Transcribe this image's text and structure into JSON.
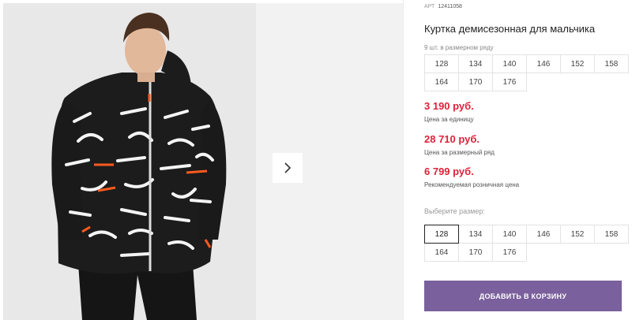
{
  "gallery": {
    "photo_alt": "boy-in-printed-jacket",
    "next_icon": "chevron-right-icon"
  },
  "product": {
    "sku_label": "АРТ",
    "sku_code": "12411058",
    "title": "Куртка демисезонная для мальчика",
    "row_note": "9 шт. в размерном ряду",
    "row_sizes": [
      "128",
      "134",
      "140",
      "146",
      "152",
      "158",
      "164",
      "170",
      "176"
    ]
  },
  "prices": {
    "unit": {
      "value": "3 190 руб.",
      "label": "Цена за единицу"
    },
    "row": {
      "value": "28 710 руб.",
      "label": "Цена за размерный ряд"
    },
    "retail": {
      "value": "6 799 руб.",
      "label": "Рекомендуемая розничная цена"
    }
  },
  "size_picker": {
    "label": "Выберите размер:",
    "sizes": [
      "128",
      "134",
      "140",
      "146",
      "152",
      "158",
      "164",
      "170",
      "176"
    ],
    "selected": "128"
  },
  "cart": {
    "button_label": "ДОБАВИТЬ В КОРЗИНУ"
  },
  "colors": {
    "price": "#e0203a",
    "button": "#7a609c"
  }
}
